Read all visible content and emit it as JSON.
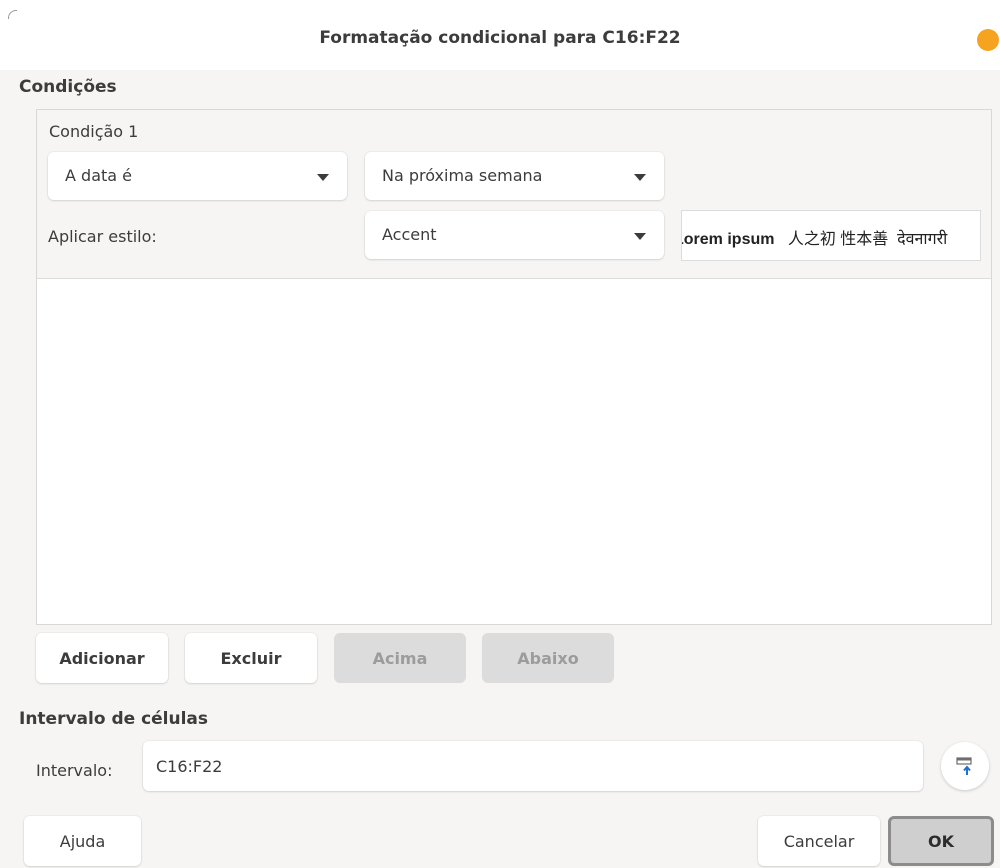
{
  "window": {
    "title": "Formatação condicional para C16:F22"
  },
  "conditions": {
    "heading": "Condições",
    "items": [
      {
        "label": "Condição 1",
        "type_value": "A data é",
        "date_value": "Na próxima semana",
        "apply_style_label": "Aplicar estilo:",
        "style_value": "Accent",
        "preview_text": "Lorem ipsum",
        "preview_cjk": "人之初 性本善",
        "preview_devanagari": "देवनागरी"
      }
    ]
  },
  "buttons": {
    "add": "Adicionar",
    "delete": "Excluir",
    "up": "Acima",
    "down": "Abaixo",
    "help": "Ajuda",
    "cancel": "Cancelar",
    "ok": "OK"
  },
  "cell_range": {
    "heading": "Intervalo de células",
    "label": "Intervalo:",
    "value": "C16:F22"
  },
  "colors": {
    "close_button": "#f6a41f",
    "background": "#f6f5f4",
    "disabled_button": "#dcdcdc"
  }
}
